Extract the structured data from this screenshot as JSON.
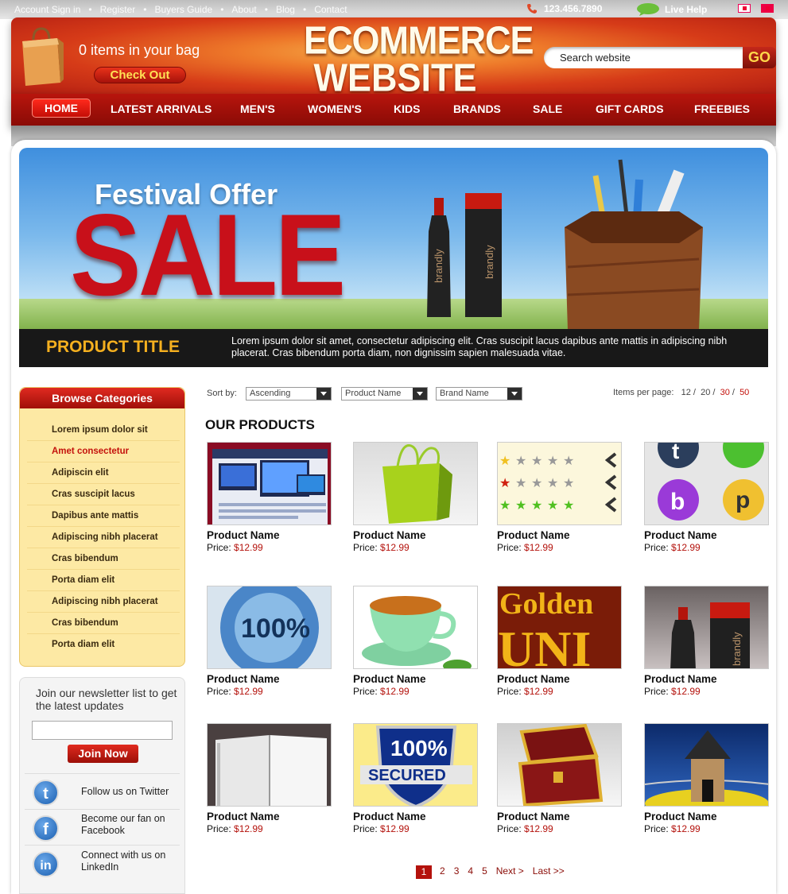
{
  "utility": {
    "links": [
      "Account Sign in",
      "Register",
      "Buyers Guide",
      "About",
      "Blog",
      "Contact"
    ],
    "phone": "123.456.7890",
    "live_help": "Live Help"
  },
  "header": {
    "cart_text": "0 items in your bag",
    "checkout_label": "Check Out",
    "logo_line1": "ECOMMERCE",
    "logo_line2": "WEBSITE",
    "search_placeholder": "Search website",
    "go_label": "GO"
  },
  "nav": {
    "items": [
      "HOME",
      "LATEST ARRIVALS",
      "MEN'S",
      "WOMEN'S",
      "KIDS",
      "BRANDS",
      "SALE",
      "GIFT CARDS",
      "FREEBIES"
    ]
  },
  "banner": {
    "festival": "Festival Offer",
    "sale": "SALE",
    "bottle_brand": "brandly",
    "product_title": "PRODUCT TITLE",
    "description": "Lorem ipsum dolor sit amet, consectetur adipiscing elit. Cras suscipit lacus dapibus ante mattis in adipiscing nibh placerat. Cras bibendum porta diam, non dignissim sapien malesuada vitae."
  },
  "sidebar": {
    "categories_title": "Browse Categories",
    "categories": [
      "Lorem ipsum dolor sit",
      "Amet consectetur",
      "Adipiscin elit",
      "Cras suscipit lacus",
      "Dapibus ante mattis",
      "Adipiscing nibh placerat",
      "Cras bibendum",
      "Porta diam elit",
      "Adipiscing nibh placerat",
      "Cras bibendum",
      "Porta diam elit"
    ],
    "selected_category": 1,
    "newsletter_text": "Join our newsletter list to get the latest updates",
    "join_label": "Join Now",
    "social": [
      {
        "icon": "twitter-icon",
        "letter": "t",
        "text": "Follow us on Twitter"
      },
      {
        "icon": "facebook-icon",
        "letter": "f",
        "text": "Become our fan on Facebook"
      },
      {
        "icon": "linkedin-icon",
        "letter": "in",
        "text": "Connect with us on LinkedIn"
      }
    ]
  },
  "toolbar": {
    "sort_label": "Sort by:",
    "sort_order": "Ascending",
    "sort_field1": "Product Name",
    "sort_field2": "Brand Name",
    "ipp_label": "Items per page:",
    "ipp_options": [
      "12",
      "20",
      "30",
      "50"
    ]
  },
  "products": {
    "section_title": "OUR PRODUCTS",
    "price_label": "Price:",
    "items": [
      {
        "name": "Product Name",
        "price": "$12.99",
        "image": "website-template"
      },
      {
        "name": "Product Name",
        "price": "$12.99",
        "image": "shopping-bag"
      },
      {
        "name": "Product Name",
        "price": "$12.99",
        "image": "star-rating"
      },
      {
        "name": "Product Name",
        "price": "$12.99",
        "image": "social-icons"
      },
      {
        "name": "Product Name",
        "price": "$12.99",
        "image": "satisfaction-seal",
        "seal_text": "100%"
      },
      {
        "name": "Product Name",
        "price": "$12.99",
        "image": "tea-cup"
      },
      {
        "name": "Product Name",
        "price": "$12.99",
        "image": "golden-text",
        "text": "Golden"
      },
      {
        "name": "Product Name",
        "price": "$12.99",
        "image": "bottles"
      },
      {
        "name": "Product Name",
        "price": "$12.99",
        "image": "open-book"
      },
      {
        "name": "Product Name",
        "price": "$12.99",
        "image": "secured-shield",
        "badge_text": "100%",
        "badge_sub": "SECURED"
      },
      {
        "name": "Product Name",
        "price": "$12.99",
        "image": "treasure-chest"
      },
      {
        "name": "Product Name",
        "price": "$12.99",
        "image": "hut"
      }
    ]
  },
  "pagination": {
    "pages": [
      "1",
      "2",
      "3",
      "4",
      "5"
    ],
    "current": "1",
    "next": "Next >",
    "last": "Last >>"
  },
  "colors": {
    "brand_red": "#b4120c",
    "accent_orange": "#ee7a2a",
    "category_bg": "#fde9a4"
  }
}
